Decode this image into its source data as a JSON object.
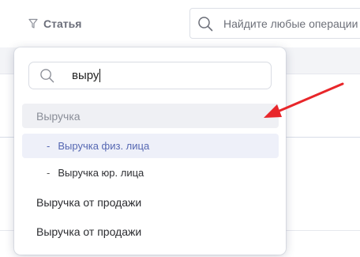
{
  "toolbar": {
    "filter_label": "Статья",
    "filter_icon": "funnel-icon",
    "search_placeholder": "Найдите любые операции",
    "search_icon": "search-icon"
  },
  "dropdown": {
    "search_value": "выру",
    "search_icon": "search-icon",
    "options": [
      {
        "type": "group",
        "label": "Выручка",
        "state": "disabled"
      },
      {
        "type": "child",
        "prefix": "-",
        "label": "Выручка физ. лица",
        "state": "highlighted"
      },
      {
        "type": "child",
        "prefix": "-",
        "label": "Выручка юр. лица"
      },
      {
        "type": "item",
        "label": "Выручка от продажи"
      },
      {
        "type": "item",
        "label": "Выручка от продажи"
      }
    ]
  },
  "annotation": {
    "type": "arrow",
    "color": "#e8262a"
  },
  "colors": {
    "accent": "#5567b2",
    "highlight_bg": "#eef0f9",
    "group_bg": "#eff0f4",
    "arrow": "#e8262a"
  }
}
